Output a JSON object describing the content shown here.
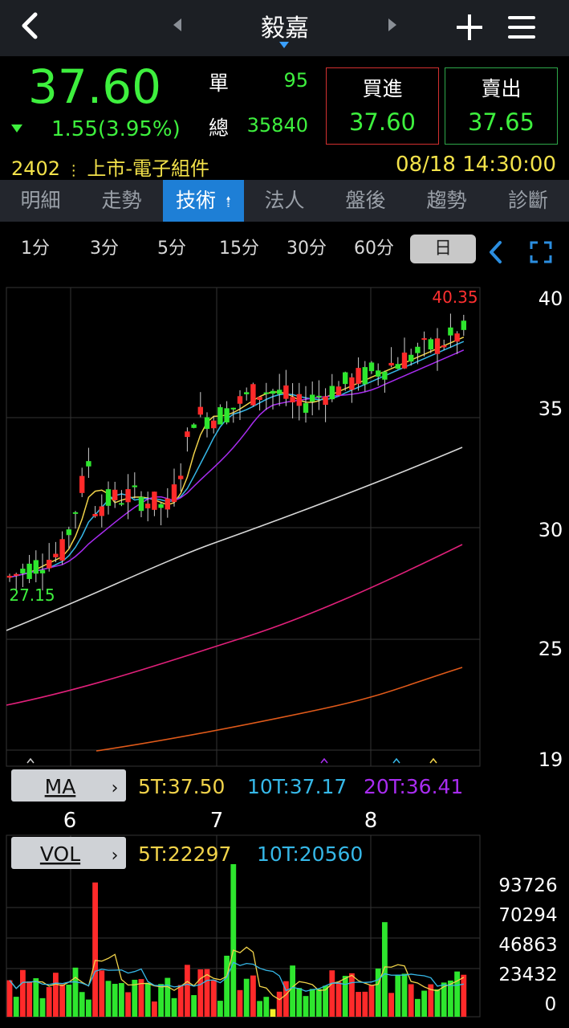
{
  "header": {
    "title": "毅嘉"
  },
  "quote": {
    "price": "37.60",
    "change": "1.55(3.95%)",
    "single_label": "單",
    "single_value": "95",
    "total_label": "總",
    "total_value": "35840",
    "buy_label": "買進",
    "buy_price": "37.60",
    "sell_label": "賣出",
    "sell_price": "37.65",
    "code": "2402",
    "market": "上市-電子組件",
    "datetime": "08/18 14:30:00"
  },
  "tabs": [
    "明細",
    "走勢",
    "技術",
    "法人",
    "盤後",
    "趨勢",
    "診斷"
  ],
  "active_tab": "技術",
  "intervals": [
    "1分",
    "3分",
    "5分",
    "15分",
    "30分",
    "60分",
    "日"
  ],
  "active_interval": "日",
  "price_axis": {
    "labels": [
      "40",
      "35",
      "30",
      "25",
      "19"
    ],
    "ylim": [
      19,
      40.35
    ]
  },
  "chart_annotations": {
    "high": "40.35",
    "low": "27.15"
  },
  "month_labels": [
    "6",
    "7",
    "8"
  ],
  "ma_panel": {
    "button": "MA",
    "ma5": "5T:37.50",
    "ma10": "10T:37.17",
    "ma20": "20T:36.41"
  },
  "vol_panel": {
    "button": "VOL",
    "ma5": "5T:22297",
    "ma10": "10T:20560",
    "axis_labels": [
      "93726",
      "70294",
      "46863",
      "23432",
      "0"
    ]
  },
  "colors": {
    "up": "#ff2a2a",
    "down": "#2ee62e",
    "ma5": "#f1d34a",
    "ma10": "#36b8e8",
    "ma20": "#a82cf0",
    "ma60": "#d8d8d8",
    "ma120": "#e0207a",
    "ma240": "#e05a1a",
    "accent": "#1e7fd6"
  },
  "icons": [
    "back-icon",
    "prev-arrow-icon",
    "next-arrow-icon",
    "plus-icon",
    "menu-icon",
    "tab-settings-icon",
    "collapse-icon",
    "fullscreen-icon"
  ]
}
